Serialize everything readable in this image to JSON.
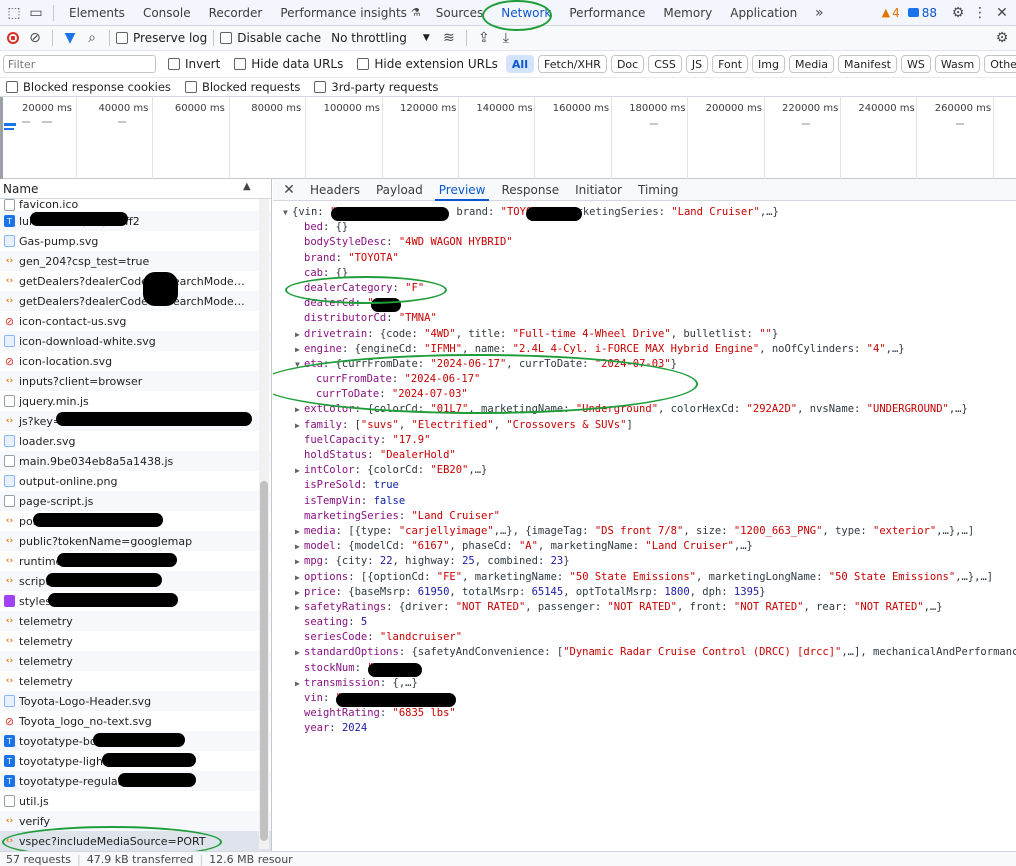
{
  "toolbar": {
    "tabs": [
      "Elements",
      "Console",
      "Recorder",
      "Performance insights",
      "Sources",
      "Network",
      "Performance",
      "Memory",
      "Application"
    ],
    "warnings_count": "4",
    "issues_count": "88"
  },
  "controls": {
    "preserve_log": "Preserve log",
    "disable_cache": "Disable cache",
    "throttling": "No throttling"
  },
  "filters": {
    "placeholder": "Filter",
    "invert": "Invert",
    "hide_data_urls": "Hide data URLs",
    "hide_extension_urls": "Hide extension URLs",
    "types": [
      "All",
      "Fetch/XHR",
      "Doc",
      "CSS",
      "JS",
      "Font",
      "Img",
      "Media",
      "Manifest",
      "WS",
      "Wasm",
      "Other"
    ],
    "blocked_cookies": "Blocked response cookies",
    "blocked_requests": "Blocked requests",
    "third_party": "3rd-party requests"
  },
  "overview": {
    "ticks": [
      "20000 ms",
      "40000 ms",
      "60000 ms",
      "80000 ms",
      "100000 ms",
      "120000 ms",
      "140000 ms",
      "160000 ms",
      "180000 ms",
      "200000 ms",
      "220000 ms",
      "240000 ms",
      "260000 ms"
    ]
  },
  "requests": {
    "header": "Name",
    "rows": [
      {
        "name": "favicon.ico",
        "icon": "doc"
      },
      {
        "name": "luiaDsNclhQ8tQ.woff2",
        "icon": "font"
      },
      {
        "name": "Gas-pump.svg",
        "icon": "img"
      },
      {
        "name": "gen_204?csp_test=true",
        "icon": "js"
      },
      {
        "name": "getDealers?dealerCode=         xsearchMode…",
        "icon": "js"
      },
      {
        "name": "getDealers?dealerCode=         xsearchMode…",
        "icon": "js"
      },
      {
        "name": "icon-contact-us.svg",
        "icon": "red"
      },
      {
        "name": "icon-download-white.svg",
        "icon": "img"
      },
      {
        "name": "icon-location.svg",
        "icon": "red"
      },
      {
        "name": "inputs?client=browser",
        "icon": "js"
      },
      {
        "name": "jquery.min.js",
        "icon": "doc"
      },
      {
        "name": "js?key=",
        "icon": "js"
      },
      {
        "name": "loader.svg",
        "icon": "img"
      },
      {
        "name": "main.9be034eb8a5a1438.js",
        "icon": "doc"
      },
      {
        "name": "output-online.png",
        "icon": "img"
      },
      {
        "name": "page-script.js",
        "icon": "doc"
      },
      {
        "name": "pol",
        "icon": "js"
      },
      {
        "name": "public?tokenName=googlemap",
        "icon": "js"
      },
      {
        "name": "runtime",
        "icon": "js"
      },
      {
        "name": "script",
        "icon": "js"
      },
      {
        "name": "styles.",
        "icon": "css"
      },
      {
        "name": "telemetry",
        "icon": "js"
      },
      {
        "name": "telemetry",
        "icon": "js"
      },
      {
        "name": "telemetry",
        "icon": "js"
      },
      {
        "name": "telemetry",
        "icon": "js"
      },
      {
        "name": "Toyota-Logo-Header.svg",
        "icon": "img"
      },
      {
        "name": "Toyota_logo_no-text.svg",
        "icon": "red"
      },
      {
        "name": "toyotatype-bol",
        "icon": "font"
      },
      {
        "name": "toyotatype-light.",
        "icon": "font"
      },
      {
        "name": "toyotatype-regular.5a",
        "icon": "font"
      },
      {
        "name": "util.js",
        "icon": "doc"
      },
      {
        "name": "verify",
        "icon": "js"
      },
      {
        "name": "vspec?includeMediaSource=PORT",
        "icon": "js"
      }
    ]
  },
  "status_bar": {
    "requests": "57 requests",
    "transferred": "47.9 kB transferred",
    "resources": "12.6 MB resour"
  },
  "detail": {
    "tabs": [
      "Headers",
      "Payload",
      "Preview",
      "Response",
      "Initiator",
      "Timing"
    ],
    "preview_lines": [
      {
        "ind": 0,
        "tri": "▼",
        "html": "<span class='p'>{vin: </span><span class='s'>\"                 \"</span><span class='p'>, stockNum: </span><span class='s'>\"        \"</span><span class='p'>, brand: </span><span class='s'>\"TOYOTA\"</span><span class='p'>, marketingSeries: </span><span class='s'>\"Land Cruiser\"</span><span class='p'>,…}</span>"
      },
      {
        "ind": 1,
        "tri": "",
        "html": "<span class='k'>bed</span><span class='p'>: {}</span>"
      },
      {
        "ind": 1,
        "tri": "",
        "html": "<span class='k'>bodyStyleDesc</span><span class='p'>: </span><span class='s'>\"4WD WAGON HYBRID\"</span>"
      },
      {
        "ind": 1,
        "tri": "",
        "html": "<span class='k'>brand</span><span class='p'>: </span><span class='s'>\"TOYOTA\"</span>"
      },
      {
        "ind": 1,
        "tri": "",
        "html": "<span class='k'>cab</span><span class='p'>: {}</span>"
      },
      {
        "ind": 1,
        "tri": "",
        "html": "<span class='k'>dealerCategory</span><span class='p'>: </span><span class='s'>\"F\"</span>"
      },
      {
        "ind": 1,
        "tri": "",
        "html": "<span class='k'>dealerCd</span><span class='p'>: </span><span class='s'>\"     \"</span>"
      },
      {
        "ind": 1,
        "tri": "",
        "html": "<span class='k'>distributorCd</span><span class='p'>: </span><span class='s'>\"TMNA\"</span>"
      },
      {
        "ind": 1,
        "tri": "▶",
        "html": "<span class='k'>drivetrain</span><span class='p'>: {code: </span><span class='s'>\"4WD\"</span><span class='p'>, title: </span><span class='s'>\"Full-time 4-Wheel Drive\"</span><span class='p'>, bulletlist: </span><span class='s'>\"\"</span><span class='p'>}</span>"
      },
      {
        "ind": 1,
        "tri": "▶",
        "html": "<span class='k'>engine</span><span class='p'>: {engineCd: </span><span class='s'>\"IFMH\"</span><span class='p'>, name: </span><span class='s'>\"2.4L 4-Cyl. i-FORCE MAX Hybrid Engine\"</span><span class='p'>, noOfCylinders: </span><span class='s'>\"4\"</span><span class='p'>,…}</span>"
      },
      {
        "ind": 1,
        "tri": "▼",
        "html": "<span class='k'>eta</span><span class='p'>: {currFromDate: </span><span class='s'>\"2024-06-17\"</span><span class='p'>, currToDate: </span><span class='s'>\"2024-07-03\"</span><span class='p'>}</span>"
      },
      {
        "ind": 2,
        "tri": "",
        "html": "<span class='k'>currFromDate</span><span class='p'>: </span><span class='s'>\"2024-06-17\"</span>"
      },
      {
        "ind": 2,
        "tri": "",
        "html": "<span class='k'>currToDate</span><span class='p'>: </span><span class='s'>\"2024-07-03\"</span>"
      },
      {
        "ind": 1,
        "tri": "▶",
        "html": "<span class='k'>extColor</span><span class='p'>: {colorCd: </span><span class='s'>\"01L7\"</span><span class='p'>, marketingName: </span><span class='s'>\"Underground\"</span><span class='p'>, colorHexCd: </span><span class='s'>\"292A2D\"</span><span class='p'>, nvsName: </span><span class='s'>\"UNDERGROUND\"</span><span class='p'>,…}</span>"
      },
      {
        "ind": 1,
        "tri": "▶",
        "html": "<span class='k'>family</span><span class='p'>: [</span><span class='s'>\"suvs\"</span><span class='p'>, </span><span class='s'>\"Electrified\"</span><span class='p'>, </span><span class='s'>\"Crossovers &amp; SUVs\"</span><span class='p'>]</span>"
      },
      {
        "ind": 1,
        "tri": "",
        "html": "<span class='k'>fuelCapacity</span><span class='p'>: </span><span class='s'>\"17.9\"</span>"
      },
      {
        "ind": 1,
        "tri": "",
        "html": "<span class='k'>holdStatus</span><span class='p'>: </span><span class='s'>\"DealerHold\"</span>"
      },
      {
        "ind": 1,
        "tri": "▶",
        "html": "<span class='k'>intColor</span><span class='p'>: {colorCd: </span><span class='s'>\"EB20\"</span><span class='p'>,…}</span>"
      },
      {
        "ind": 1,
        "tri": "",
        "html": "<span class='k'>isPreSold</span><span class='p'>: </span><span class='b'>true</span>"
      },
      {
        "ind": 1,
        "tri": "",
        "html": "<span class='k'>isTempVin</span><span class='p'>: </span><span class='b'>false</span>"
      },
      {
        "ind": 1,
        "tri": "",
        "html": "<span class='k'>marketingSeries</span><span class='p'>: </span><span class='s'>\"Land Cruiser\"</span>"
      },
      {
        "ind": 1,
        "tri": "▶",
        "html": "<span class='k'>media</span><span class='p'>: [{type: </span><span class='s'>\"carjellyimage\"</span><span class='p'>,…}, {imageTag: </span><span class='s'>\"DS front 7/8\"</span><span class='p'>, size: </span><span class='s'>\"1200_663_PNG\"</span><span class='p'>, type: </span><span class='s'>\"exterior\"</span><span class='p'>,…},…]</span>"
      },
      {
        "ind": 1,
        "tri": "▶",
        "html": "<span class='k'>model</span><span class='p'>: {modelCd: </span><span class='s'>\"6167\"</span><span class='p'>, phaseCd: </span><span class='s'>\"A\"</span><span class='p'>, marketingName: </span><span class='s'>\"Land Cruiser\"</span><span class='p'>,…}</span>"
      },
      {
        "ind": 1,
        "tri": "▶",
        "html": "<span class='k'>mpg</span><span class='p'>: {city: </span><span class='n'>22</span><span class='p'>, highway: </span><span class='n'>25</span><span class='p'>, combined: </span><span class='n'>23</span><span class='p'>}</span>"
      },
      {
        "ind": 1,
        "tri": "▶",
        "html": "<span class='k'>options</span><span class='p'>: [{optionCd: </span><span class='s'>\"FE\"</span><span class='p'>, marketingName: </span><span class='s'>\"50 State Emissions\"</span><span class='p'>, marketingLongName: </span><span class='s'>\"50 State Emissions\"</span><span class='p'>,…},…]</span>"
      },
      {
        "ind": 1,
        "tri": "▶",
        "html": "<span class='k'>price</span><span class='p'>: {baseMsrp: </span><span class='n'>61950</span><span class='p'>, totalMsrp: </span><span class='n'>65145</span><span class='p'>, optTotalMsrp: </span><span class='n'>1800</span><span class='p'>, dph: </span><span class='n'>1395</span><span class='p'>}</span>"
      },
      {
        "ind": 1,
        "tri": "▶",
        "html": "<span class='k'>safetyRatings</span><span class='p'>: {driver: </span><span class='s'>\"NOT RATED\"</span><span class='p'>, passenger: </span><span class='s'>\"NOT RATED\"</span><span class='p'>, front: </span><span class='s'>\"NOT RATED\"</span><span class='p'>, rear: </span><span class='s'>\"NOT RATED\"</span><span class='p'>,…}</span>"
      },
      {
        "ind": 1,
        "tri": "",
        "html": "<span class='k'>seating</span><span class='p'>: </span><span class='n'>5</span>"
      },
      {
        "ind": 1,
        "tri": "",
        "html": "<span class='k'>seriesCode</span><span class='p'>: </span><span class='s'>\"landcruiser\"</span>"
      },
      {
        "ind": 1,
        "tri": "▶",
        "html": "<span class='k'>standardOptions</span><span class='p'>: {safetyAndConvenience: [</span><span class='s'>\"Dynamic Radar Cruise Control (DRCC) [drcc]\"</span><span class='p'>,…], mechanicalAndPerformance</span>"
      },
      {
        "ind": 1,
        "tri": "",
        "html": "<span class='k'>stockNum</span><span class='p'>: </span><span class='s'>\"       \"</span>"
      },
      {
        "ind": 1,
        "tri": "▶",
        "html": "<span class='k'>transmission</span><span class='p'>: {,…}</span>"
      },
      {
        "ind": 1,
        "tri": "",
        "html": "<span class='k'>vin</span><span class='p'>: </span><span class='s'>\"                 \"</span>"
      },
      {
        "ind": 1,
        "tri": "",
        "html": "<span class='k'>weightRating</span><span class='p'>: </span><span class='s'>\"6835 lbs\"</span>"
      },
      {
        "ind": 1,
        "tri": "",
        "html": "<span class='k'>year</span><span class='p'>: </span><span class='n'>2024</span>"
      }
    ]
  },
  "colors": {
    "accent": "#0b57d0",
    "annotation_ring": "#1e9e3a",
    "json_key": "#881280",
    "json_string": "#c80000",
    "json_number": "#1a1aa6"
  }
}
